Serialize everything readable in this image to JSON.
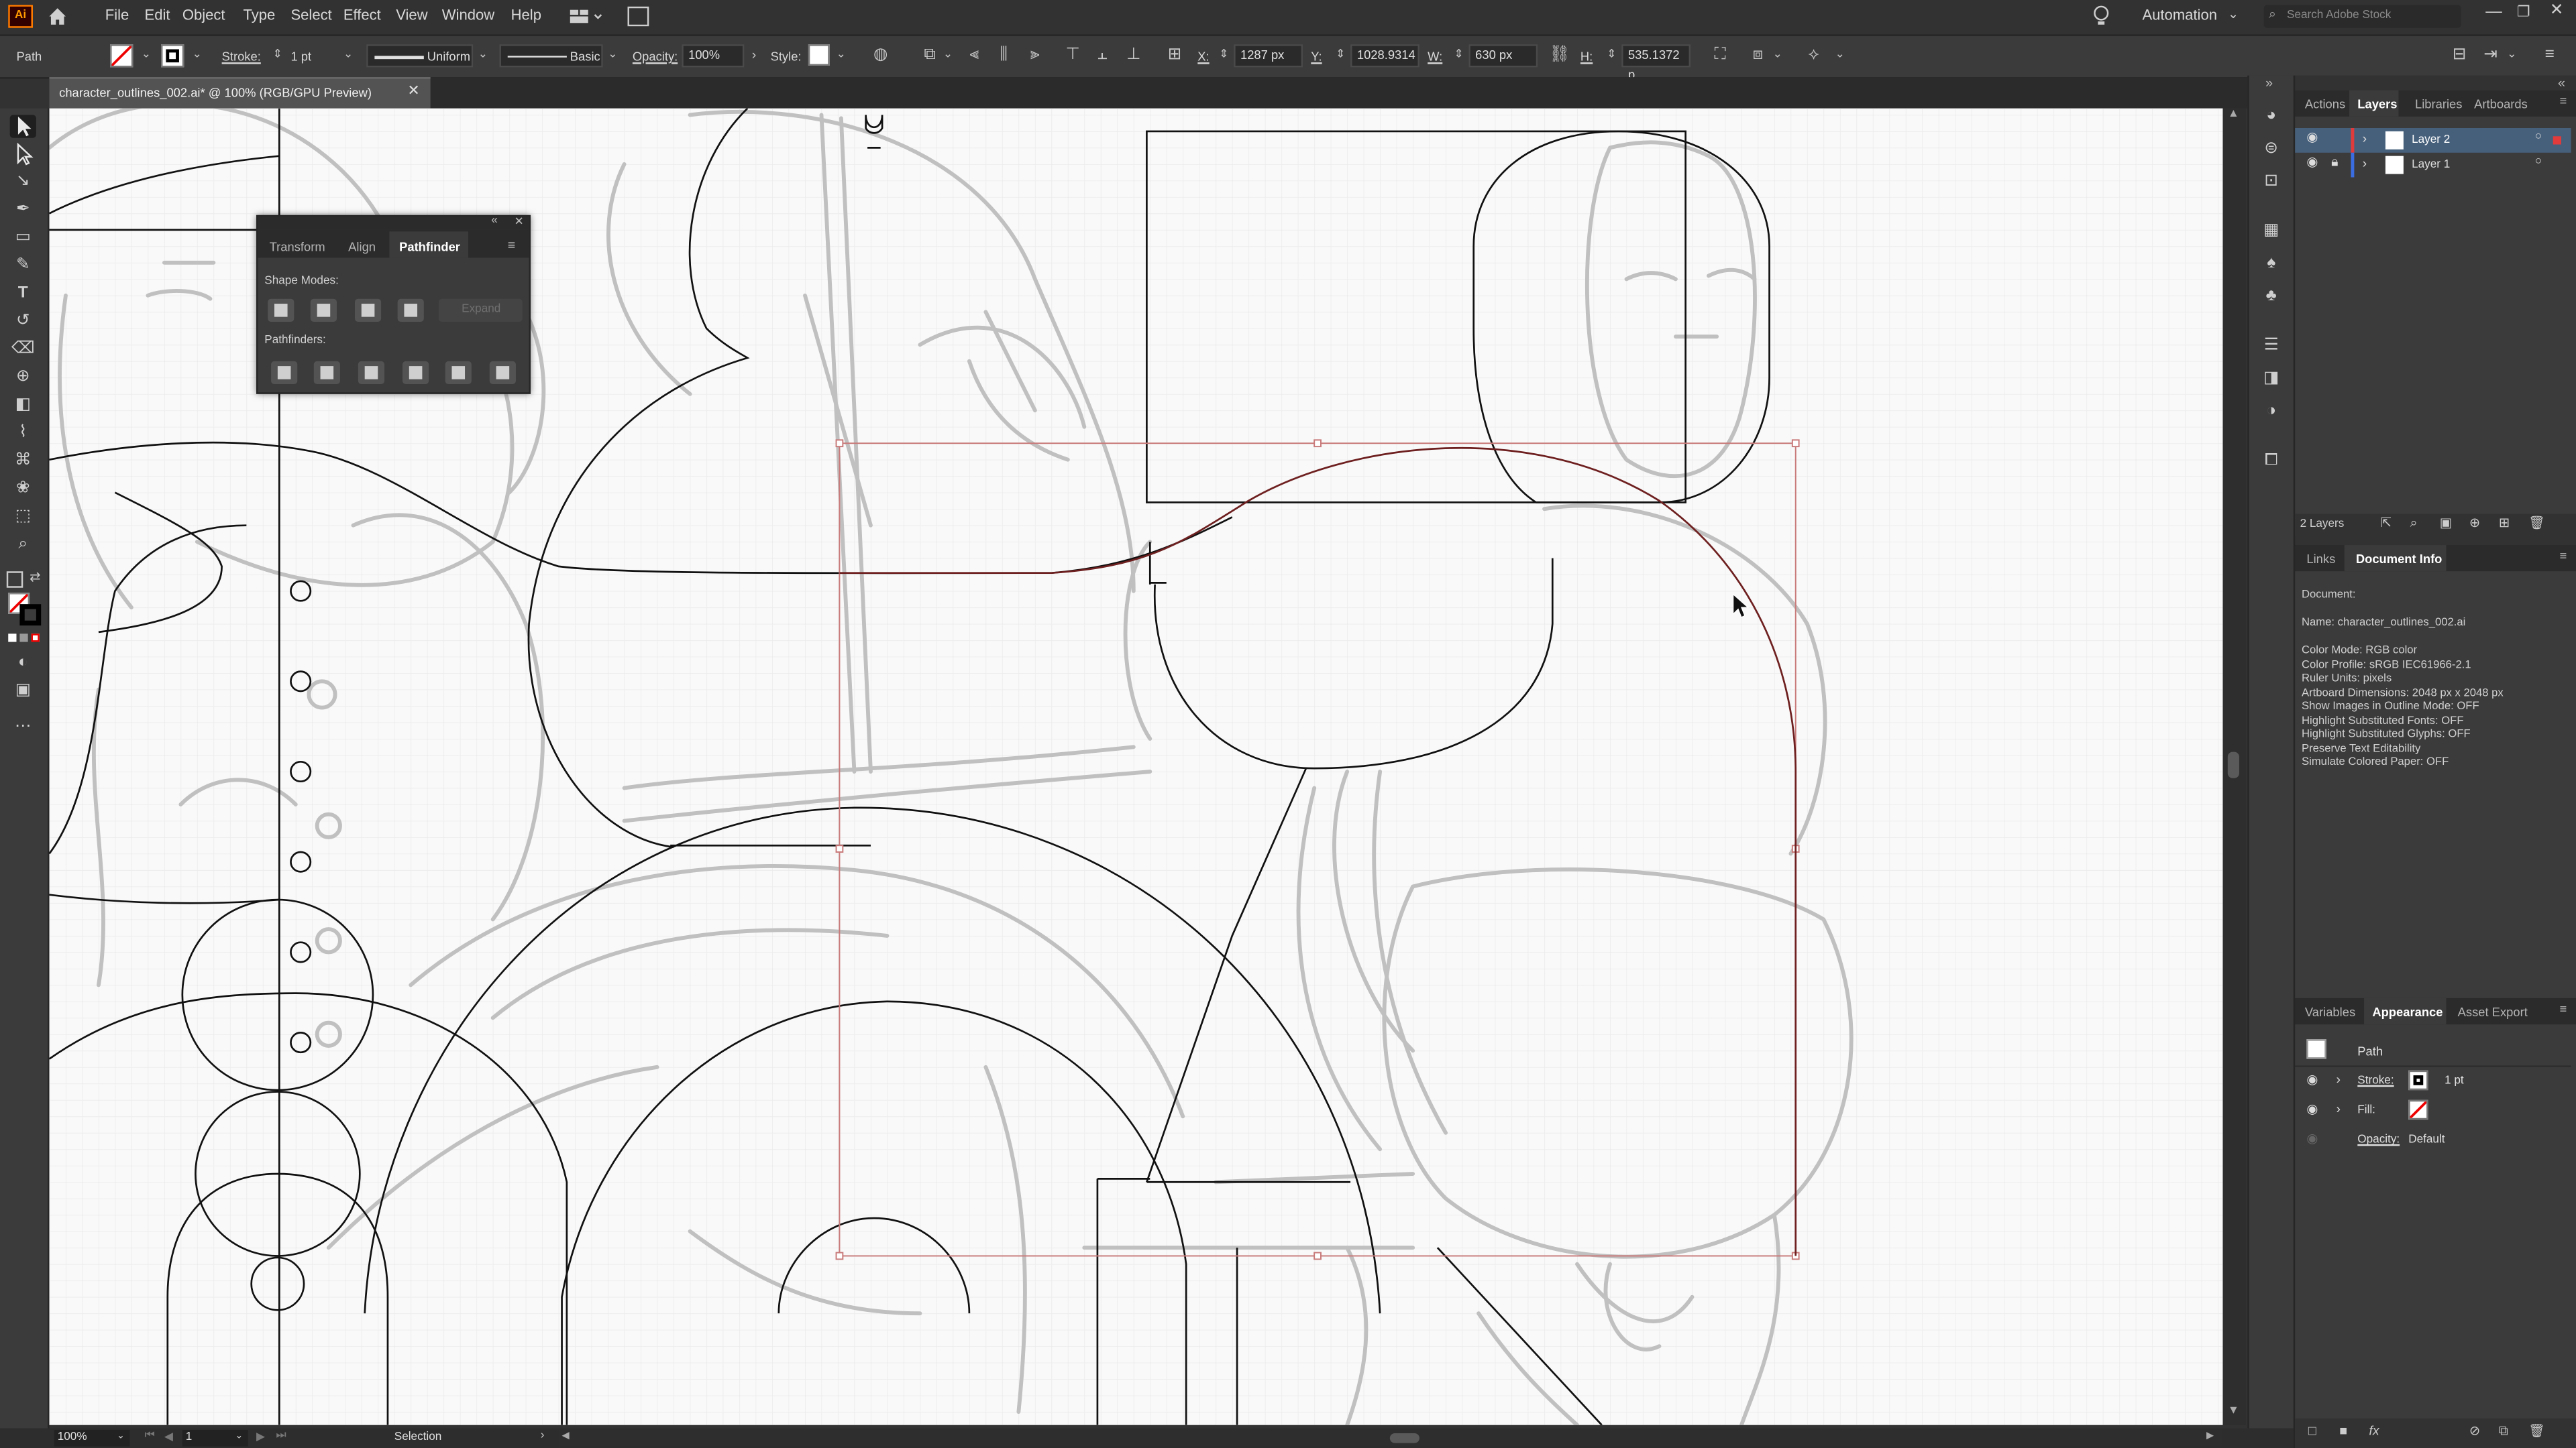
{
  "app": {
    "logo": "Ai"
  },
  "menu": [
    "File",
    "Edit",
    "Object",
    "Type",
    "Select",
    "Effect",
    "View",
    "Window",
    "Help"
  ],
  "topbar": {
    "workspace": "Automation",
    "search_placeholder": "Search Adobe Stock"
  },
  "control": {
    "selection_type": "Path",
    "stroke_label": "Stroke:",
    "stroke_weight": "1 pt",
    "profile": "Uniform",
    "brush": "Basic",
    "opacity_label": "Opacity:",
    "opacity": "100%",
    "style_label": "Style:",
    "x_label": "X:",
    "x_value": "1287 px",
    "y_label": "Y:",
    "y_value": "1028.9314",
    "w_label": "W:",
    "w_value": "630 px",
    "h_label": "H:",
    "h_value": "535.1372 p"
  },
  "document_tab": {
    "title": "character_outlines_002.ai* @ 100% (RGB/GPU Preview)"
  },
  "pathfinder_panel": {
    "tabs": [
      "Transform",
      "Align",
      "Pathfinder"
    ],
    "active_tab": "Pathfinder",
    "shape_modes_label": "Shape Modes:",
    "expand_label": "Expand",
    "pathfinders_label": "Pathfinders:"
  },
  "layers_panel": {
    "tabs": [
      "Actions",
      "Layers",
      "Libraries",
      "Artboards"
    ],
    "active_tab": "Layers",
    "layers": [
      {
        "name": "Layer 2",
        "color": "#e23b3b",
        "selected": true,
        "locked": false
      },
      {
        "name": "Layer 1",
        "color": "#3b6de2",
        "selected": false,
        "locked": true
      }
    ],
    "count": "2 Layers"
  },
  "docinfo_panel": {
    "tabs": [
      "Links",
      "Document Info"
    ],
    "active_tab": "Document Info",
    "lines": [
      "Document:",
      "",
      "Name: character_outlines_002.ai",
      "",
      "Color Mode: RGB color",
      "Color Profile: sRGB IEC61966-2.1",
      "Ruler Units: pixels",
      "Artboard Dimensions: 2048 px x 2048 px",
      "Show Images in Outline Mode: OFF",
      "Highlight Substituted Fonts: OFF",
      "Highlight Substituted Glyphs: OFF",
      "Preserve Text Editability",
      "Simulate Colored Paper: OFF"
    ]
  },
  "appearance_panel": {
    "tabs": [
      "Variables",
      "Appearance",
      "Asset Export"
    ],
    "active_tab": "Appearance",
    "target": "Path",
    "stroke_label": "Stroke:",
    "stroke_value": "1 pt",
    "fill_label": "Fill:",
    "opacity_label": "Opacity:",
    "opacity_value": "Default"
  },
  "status": {
    "zoom": "100%",
    "artboard": "1",
    "tool": "Selection"
  },
  "colors": {
    "selection": "#c97a7a",
    "selected_path": "#6e1f1f",
    "sketch": "#bcbcbc",
    "ink": "#111111",
    "brand": "#cc0a0a"
  }
}
